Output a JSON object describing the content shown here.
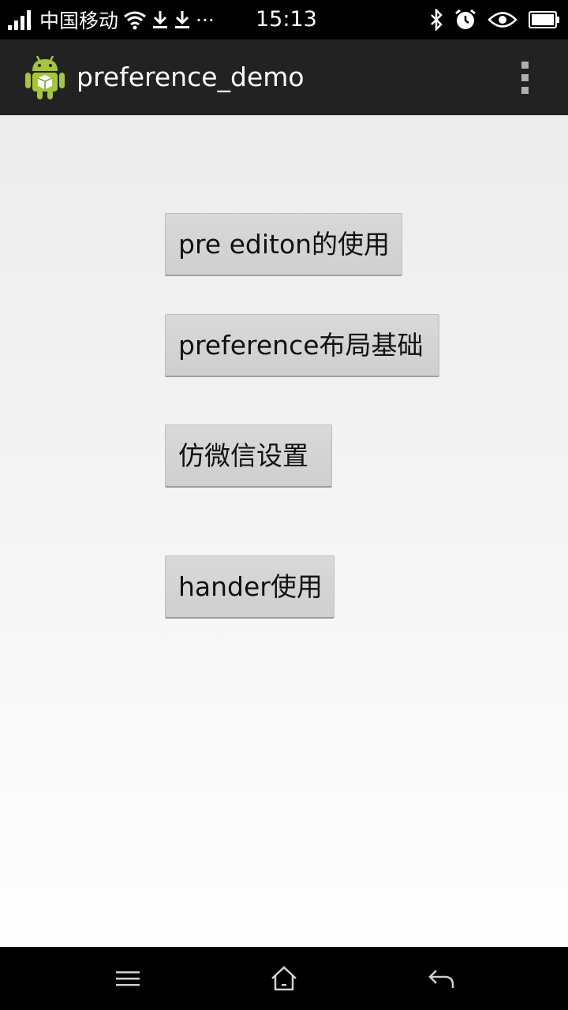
{
  "status_bar": {
    "carrier": "中国移动",
    "time": "15:13",
    "more_indicator": "···",
    "icons": [
      "signal-icon",
      "wifi-icon",
      "download-icon",
      "download-icon",
      "bluetooth-icon",
      "alarm-icon",
      "eye-icon",
      "battery-icon"
    ]
  },
  "action_bar": {
    "title": "preference_demo",
    "icon": "android-app-icon",
    "menu_icon": "overflow-menu-icon"
  },
  "main": {
    "buttons": [
      {
        "label": "pre editon的使用"
      },
      {
        "label": "preference布局基础"
      },
      {
        "label": "仿微信设置"
      },
      {
        "label": "hander使用"
      }
    ]
  },
  "nav_bar": {
    "icons": [
      "menu-icon",
      "home-icon",
      "back-icon"
    ]
  },
  "colors": {
    "status_bar_bg": "#000000",
    "action_bar_bg": "#222222",
    "button_bg": "#d4d4d4",
    "android_green": "#a4c639"
  }
}
